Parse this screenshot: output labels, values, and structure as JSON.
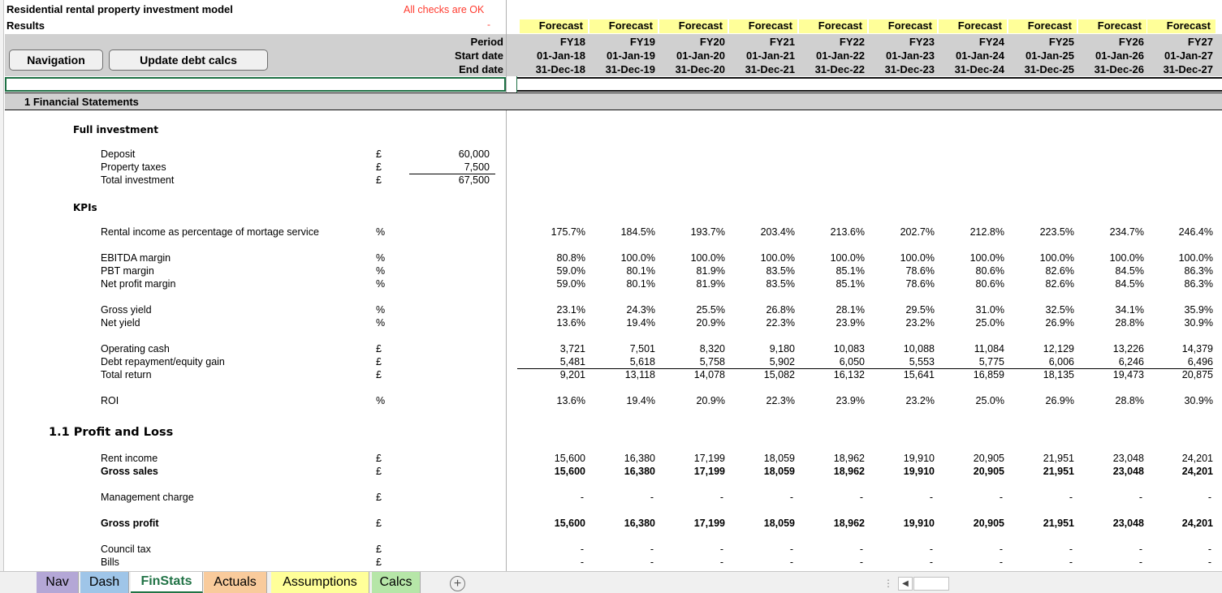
{
  "title": "Residential rental property investment model",
  "subtitle": "Results",
  "checks_status": "All checks are OK",
  "checks_dash": "-",
  "buttons": {
    "navigation": "Navigation",
    "update_debt": "Update debt calcs"
  },
  "header_labels": {
    "period": "Period",
    "start": "Start date",
    "end": "End date"
  },
  "forecast_label": "Forecast",
  "periods": [
    "FY18",
    "FY19",
    "FY20",
    "FY21",
    "FY22",
    "FY23",
    "FY24",
    "FY25",
    "FY26",
    "FY27"
  ],
  "start_dates": [
    "01-Jan-18",
    "01-Jan-19",
    "01-Jan-20",
    "01-Jan-21",
    "01-Jan-22",
    "01-Jan-23",
    "01-Jan-24",
    "01-Jan-25",
    "01-Jan-26",
    "01-Jan-27"
  ],
  "end_dates": [
    "31-Dec-18",
    "31-Dec-19",
    "31-Dec-20",
    "31-Dec-21",
    "31-Dec-22",
    "31-Dec-23",
    "31-Dec-24",
    "31-Dec-25",
    "31-Dec-26",
    "31-Dec-27"
  ],
  "section_title": "1 Financial Statements",
  "full_investment": {
    "title": "Full investment",
    "rows": [
      {
        "label": "Deposit",
        "unit": "£",
        "value": "60,000"
      },
      {
        "label": "Property taxes",
        "unit": "£",
        "value": "7,500"
      },
      {
        "label": "Total investment",
        "unit": "£",
        "value": "67,500"
      }
    ]
  },
  "kpis_title": "KPIs",
  "pl_title": "1.1 Profit and Loss",
  "rows": [
    {
      "label": "Rental income as percentage of mortage service",
      "unit": "%",
      "values": [
        "175.7%",
        "184.5%",
        "193.7%",
        "203.4%",
        "213.6%",
        "202.7%",
        "212.8%",
        "223.5%",
        "234.7%",
        "246.4%"
      ]
    },
    {
      "label": "EBITDA margin",
      "unit": "%",
      "values": [
        "80.8%",
        "100.0%",
        "100.0%",
        "100.0%",
        "100.0%",
        "100.0%",
        "100.0%",
        "100.0%",
        "100.0%",
        "100.0%"
      ]
    },
    {
      "label": "PBT margin",
      "unit": "%",
      "values": [
        "59.0%",
        "80.1%",
        "81.9%",
        "83.5%",
        "85.1%",
        "78.6%",
        "80.6%",
        "82.6%",
        "84.5%",
        "86.3%"
      ]
    },
    {
      "label": "Net profit margin",
      "unit": "%",
      "values": [
        "59.0%",
        "80.1%",
        "81.9%",
        "83.5%",
        "85.1%",
        "78.6%",
        "80.6%",
        "82.6%",
        "84.5%",
        "86.3%"
      ]
    },
    {
      "label": "Gross yield",
      "unit": "%",
      "values": [
        "23.1%",
        "24.3%",
        "25.5%",
        "26.8%",
        "28.1%",
        "29.5%",
        "31.0%",
        "32.5%",
        "34.1%",
        "35.9%"
      ]
    },
    {
      "label": "Net yield",
      "unit": "%",
      "values": [
        "13.6%",
        "19.4%",
        "20.9%",
        "22.3%",
        "23.9%",
        "23.2%",
        "25.0%",
        "26.9%",
        "28.8%",
        "30.9%"
      ]
    },
    {
      "label": "Operating cash",
      "unit": "£",
      "values": [
        "3,721",
        "7,501",
        "8,320",
        "9,180",
        "10,083",
        "10,088",
        "11,084",
        "12,129",
        "13,226",
        "14,379"
      ]
    },
    {
      "label": "Debt repayment/equity gain",
      "unit": "£",
      "values": [
        "5,481",
        "5,618",
        "5,758",
        "5,902",
        "6,050",
        "5,553",
        "5,775",
        "6,006",
        "6,246",
        "6,496"
      ]
    },
    {
      "label": "Total return",
      "unit": "£",
      "values": [
        "9,201",
        "13,118",
        "14,078",
        "15,082",
        "16,132",
        "15,641",
        "16,859",
        "18,135",
        "19,473",
        "20,875"
      ]
    },
    {
      "label": "ROI",
      "unit": "%",
      "values": [
        "13.6%",
        "19.4%",
        "20.9%",
        "22.3%",
        "23.9%",
        "23.2%",
        "25.0%",
        "26.9%",
        "28.8%",
        "30.9%"
      ]
    },
    {
      "label": "Rent income",
      "unit": "£",
      "values": [
        "15,600",
        "16,380",
        "17,199",
        "18,059",
        "18,962",
        "19,910",
        "20,905",
        "21,951",
        "23,048",
        "24,201"
      ]
    },
    {
      "label": "Gross sales",
      "unit": "£",
      "values": [
        "15,600",
        "16,380",
        "17,199",
        "18,059",
        "18,962",
        "19,910",
        "20,905",
        "21,951",
        "23,048",
        "24,201"
      ]
    },
    {
      "label": "Management charge",
      "unit": "£",
      "values": [
        "-",
        "-",
        "-",
        "-",
        "-",
        "-",
        "-",
        "-",
        "-",
        "-"
      ]
    },
    {
      "label": "Gross profit",
      "unit": "£",
      "values": [
        "15,600",
        "16,380",
        "17,199",
        "18,059",
        "18,962",
        "19,910",
        "20,905",
        "21,951",
        "23,048",
        "24,201"
      ]
    },
    {
      "label": "Council tax",
      "unit": "£",
      "values": [
        "-",
        "-",
        "-",
        "-",
        "-",
        "-",
        "-",
        "-",
        "-",
        "-"
      ]
    },
    {
      "label": "Bills",
      "unit": "£",
      "values": [
        "-",
        "-",
        "-",
        "-",
        "-",
        "-",
        "-",
        "-",
        "-",
        "-"
      ]
    }
  ],
  "tabs": [
    {
      "label": "Nav",
      "color": "#b4a7d6"
    },
    {
      "label": "Dash",
      "color": "#9fc5e8"
    },
    {
      "label": "FinStats",
      "color": "#ffffff"
    },
    {
      "label": "Actuals",
      "color": "#f9cb9c"
    },
    {
      "label": "Assumptions",
      "color": "#ffff99"
    },
    {
      "label": "Calcs",
      "color": "#b6e6a8"
    }
  ],
  "add_sheet_icon": "plus-icon"
}
